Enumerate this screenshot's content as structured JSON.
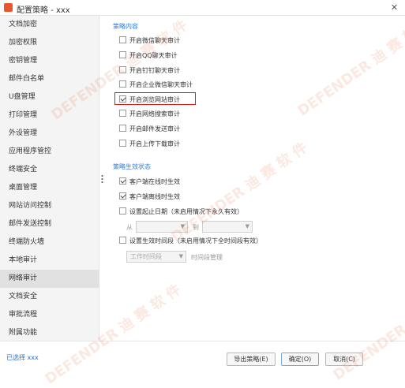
{
  "window": {
    "title": "配置策略 - xxx",
    "close_glyph": "✕"
  },
  "sidebar": {
    "items": [
      {
        "label": "文档加密"
      },
      {
        "label": "加密权限"
      },
      {
        "label": "密钥管理"
      },
      {
        "label": "邮件白名单"
      },
      {
        "label": "U盘管理"
      },
      {
        "label": "打印管理"
      },
      {
        "label": "外设管理"
      },
      {
        "label": "应用程序管控"
      },
      {
        "label": "终端安全"
      },
      {
        "label": "桌面管理"
      },
      {
        "label": "网站访问控制"
      },
      {
        "label": "邮件发送控制"
      },
      {
        "label": "终端防火墙"
      },
      {
        "label": "本地审计"
      },
      {
        "label": "网络审计",
        "active": true
      },
      {
        "label": "文档安全"
      },
      {
        "label": "审批流程"
      },
      {
        "label": "附属功能"
      }
    ],
    "selected_text": "已选择 xxx"
  },
  "policy_content": {
    "title": "策略内容",
    "items": [
      {
        "label": "开启微信聊天审计",
        "checked": false
      },
      {
        "label": "开启QQ聊天审计",
        "checked": false
      },
      {
        "label": "开启钉钉聊天审计",
        "checked": false
      },
      {
        "label": "开启企业微信聊天审计",
        "checked": false
      },
      {
        "label": "开启浏览网站审计",
        "checked": true
      },
      {
        "label": "开启网络搜索审计",
        "checked": false
      },
      {
        "label": "开启邮件发送审计",
        "checked": false
      },
      {
        "label": "开启上传下载审计",
        "checked": false
      }
    ]
  },
  "policy_status": {
    "title": "策略生效状态",
    "online": {
      "label": "客户端在线时生效",
      "checked": true
    },
    "offline": {
      "label": "客户端离线时生效",
      "checked": true
    },
    "start_date": {
      "label": "设置起止日期（未启用情况下永久有效）",
      "checked": false
    },
    "from_label": "从",
    "to_label": "到",
    "time_period": {
      "label": "设置生效时间段（未启用情况下全时间段有效）",
      "checked": false
    },
    "time_select": "工作时间段",
    "time_manage": "时间段管理"
  },
  "buttons": {
    "export": "导出策略(E)",
    "ok": "确定(O)",
    "cancel": "取消(C)"
  },
  "watermark": {
    "brand": "DEFENDER",
    "chars": "迪 赛 软 件",
    "color": "#e67346"
  }
}
